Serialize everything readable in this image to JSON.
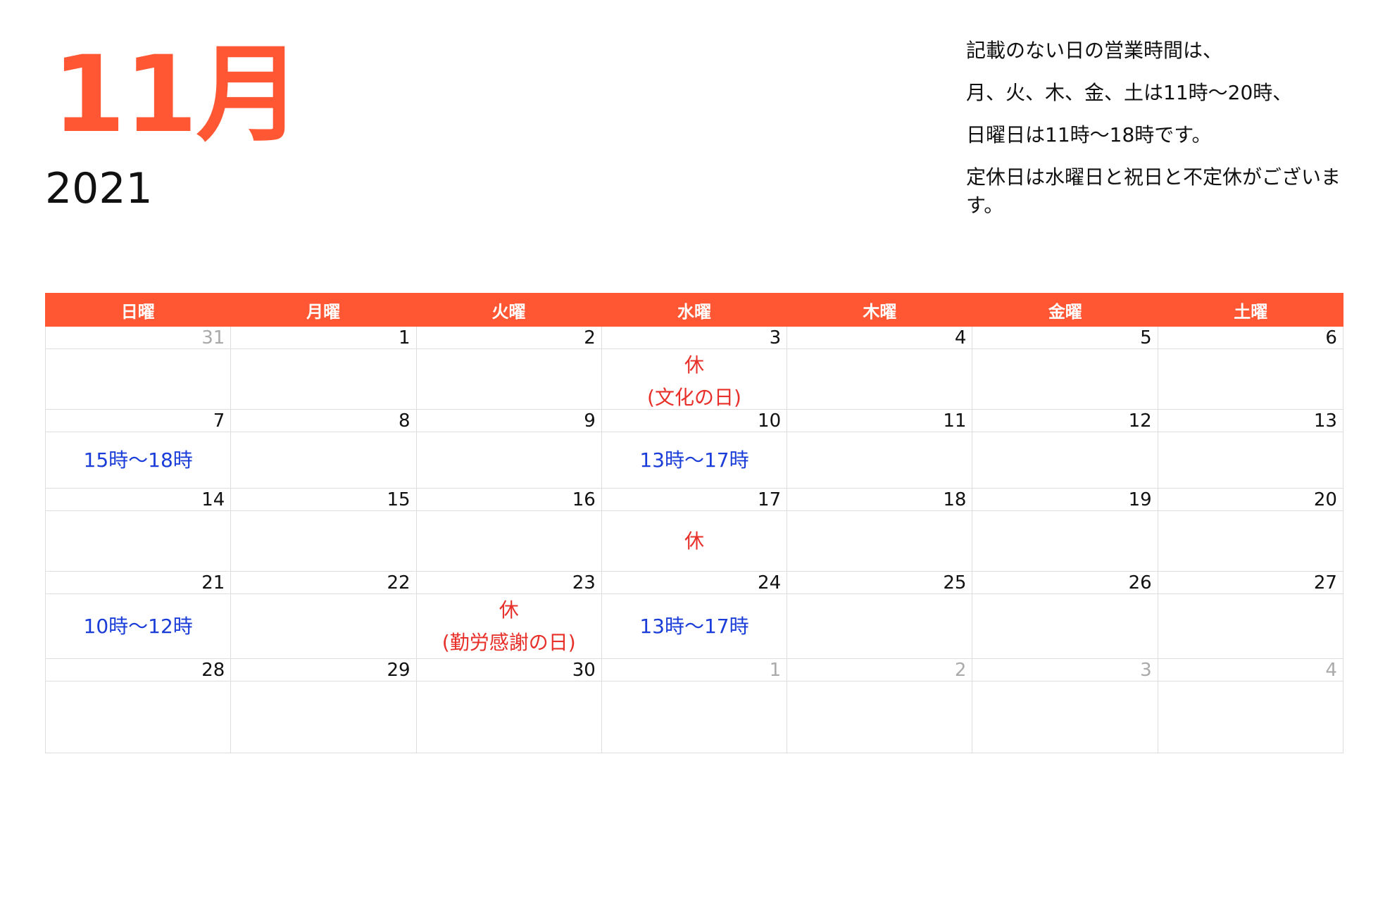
{
  "month": "11月",
  "year": "2021",
  "notes": [
    "記載のない日の営業時間は、",
    "月、火、木、金、土は11時〜20時、",
    "日曜日は11時〜18時です。",
    "定休日は水曜日と祝日と不定休がございます。"
  ],
  "colors": {
    "accent": "#FF5733",
    "closed": "#E8302A",
    "hours": "#1A3CD8",
    "muted": "#AAAAAA"
  },
  "weekdays": [
    "日曜",
    "月曜",
    "火曜",
    "水曜",
    "木曜",
    "金曜",
    "土曜"
  ],
  "weeks": [
    [
      {
        "day": "31",
        "other": true,
        "lines": []
      },
      {
        "day": "1",
        "lines": []
      },
      {
        "day": "2",
        "lines": []
      },
      {
        "day": "3",
        "lines": [
          "休",
          "(文化の日)"
        ],
        "type": "closed"
      },
      {
        "day": "4",
        "lines": []
      },
      {
        "day": "5",
        "lines": []
      },
      {
        "day": "6",
        "lines": []
      }
    ],
    [
      {
        "day": "7",
        "lines": [
          "15時〜18時"
        ],
        "type": "hours"
      },
      {
        "day": "8",
        "lines": []
      },
      {
        "day": "9",
        "lines": []
      },
      {
        "day": "10",
        "lines": [
          "13時〜17時"
        ],
        "type": "hours"
      },
      {
        "day": "11",
        "lines": []
      },
      {
        "day": "12",
        "lines": []
      },
      {
        "day": "13",
        "lines": []
      }
    ],
    [
      {
        "day": "14",
        "lines": []
      },
      {
        "day": "15",
        "lines": []
      },
      {
        "day": "16",
        "lines": []
      },
      {
        "day": "17",
        "lines": [
          "休"
        ],
        "type": "closed"
      },
      {
        "day": "18",
        "lines": []
      },
      {
        "day": "19",
        "lines": []
      },
      {
        "day": "20",
        "lines": []
      }
    ],
    [
      {
        "day": "21",
        "lines": [
          "10時〜12時"
        ],
        "type": "hours"
      },
      {
        "day": "22",
        "lines": []
      },
      {
        "day": "23",
        "lines": [
          "休",
          "(勤労感謝の日)"
        ],
        "type": "closed"
      },
      {
        "day": "24",
        "lines": [
          "13時〜17時"
        ],
        "type": "hours"
      },
      {
        "day": "25",
        "lines": []
      },
      {
        "day": "26",
        "lines": []
      },
      {
        "day": "27",
        "lines": []
      }
    ],
    [
      {
        "day": "28",
        "lines": []
      },
      {
        "day": "29",
        "lines": []
      },
      {
        "day": "30",
        "lines": []
      },
      {
        "day": "1",
        "other": true,
        "lines": []
      },
      {
        "day": "2",
        "other": true,
        "lines": []
      },
      {
        "day": "3",
        "other": true,
        "lines": []
      },
      {
        "day": "4",
        "other": true,
        "lines": []
      }
    ]
  ]
}
